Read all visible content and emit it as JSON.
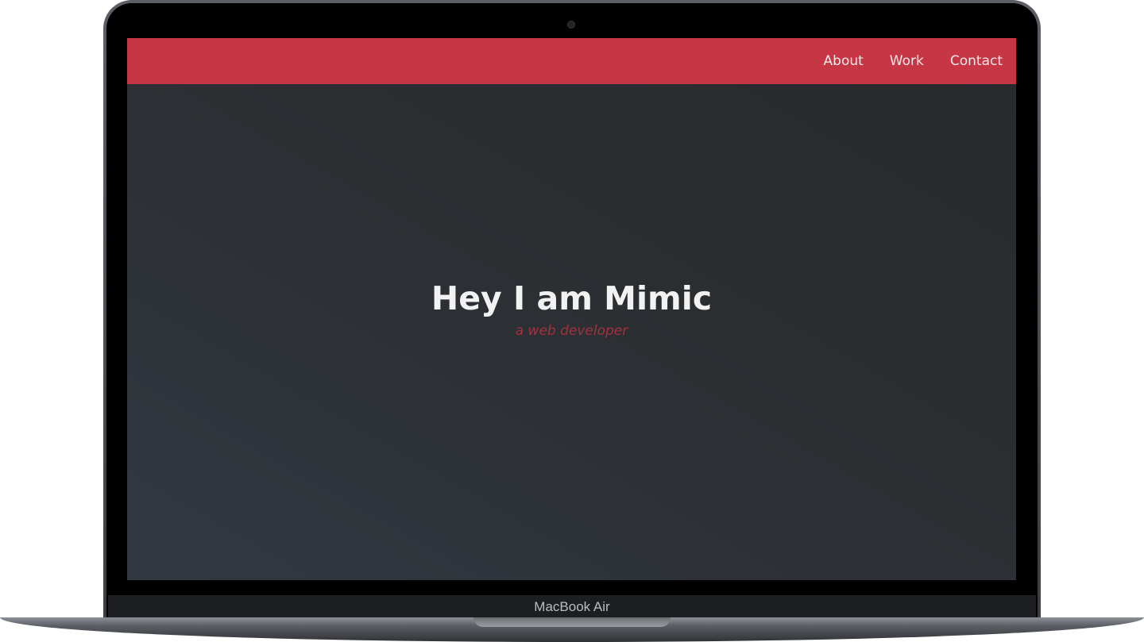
{
  "navbar": {
    "links": [
      {
        "label": "About"
      },
      {
        "label": "Work"
      },
      {
        "label": "Contact"
      }
    ]
  },
  "hero": {
    "title": "Hey I am Mimic",
    "subtitle": "a web developer"
  },
  "device": {
    "label": "MacBook Air"
  },
  "colors": {
    "accent": "#c63645",
    "subtitle": "#a3323e",
    "background": "#2b2e31"
  }
}
